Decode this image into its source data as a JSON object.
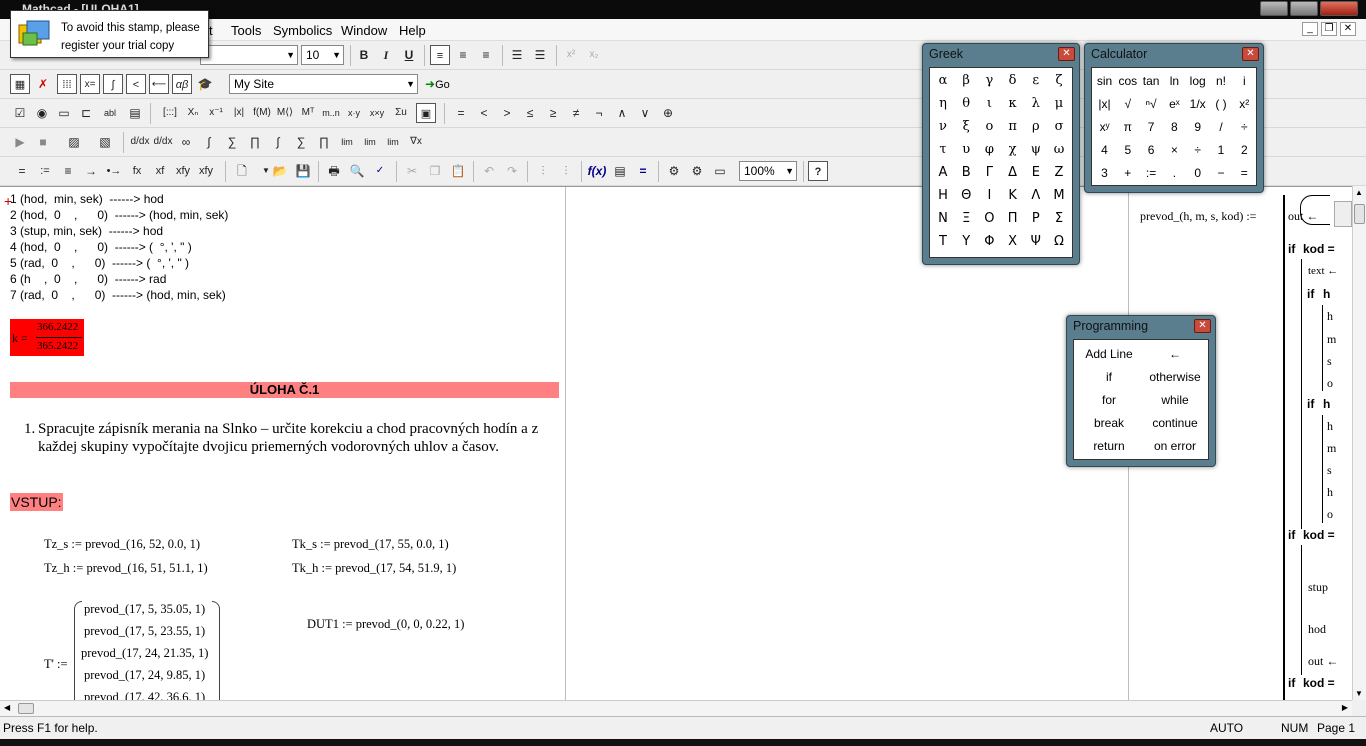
{
  "window": {
    "title": "Mathcad - [ULOHA1]"
  },
  "menubar": {
    "items": [
      "t",
      "Tools",
      "Symbolics",
      "Window",
      "Help"
    ]
  },
  "stamp": {
    "line1": "To avoid this stamp, please",
    "line2": "register your trial copy"
  },
  "format_toolbar": {
    "font_size": "10",
    "bold": "B",
    "italic": "I",
    "underline": "U",
    "superscript": "x²",
    "subscript": "x₂"
  },
  "resources_toolbar": {
    "site_value": "My Site",
    "go_label": "Go"
  },
  "evaluation_toolbar": {
    "symbols": [
      "=",
      ":=",
      "≡",
      "→",
      "•→",
      "fx",
      "xf",
      "xfy",
      "xfy"
    ]
  },
  "comparison_symbols": [
    "=",
    "<",
    ">",
    "≤",
    "≥",
    "≠",
    "¬",
    "∧",
    "∨",
    "⊕"
  ],
  "calculus_symbols": [
    "d/dx",
    "d/dx",
    "∞",
    "∫",
    "∑",
    "∏",
    "∫",
    "∑",
    "∏",
    "lim",
    "lim",
    "lim",
    "∇x"
  ],
  "matrix_symbols": [
    "[:::]",
    "Xₙ",
    "x⁻¹",
    "|x|",
    "f(M)",
    "M⟨⟩",
    "Mᵀ",
    "m..n",
    "x·y",
    "x×y",
    "Σu"
  ],
  "standard_toolbar": {
    "zoom_value": "100%"
  },
  "document": {
    "table_lines": [
      "1 (hod,  min, sek)  ------> hod",
      "2 (hod,  0    ,      0)  ------> (hod, min, sek)",
      "3 (stup, min, sek)  ------> hod",
      "4 (hod,  0    ,      0)  ------> (  °, ', \" )",
      "5 (rad,  0    ,      0)  ------> (  °, ', \" )",
      "6 (h    ,  0    ,      0)  ------> rad",
      "7 (rad,  0    ,      0)  ------> (hod, min, sek)"
    ],
    "k_label": "k =",
    "k_numerator": "366.2422",
    "k_denominator": "365.2422",
    "section_title": "ÚLOHA Č.1",
    "task_number": "1.",
    "task_text": "Spracujte zápisník merania na Slnko – určite korekciu a chod pracovných hodín a z každej skupiny vypočítajte dvojicu priemerných vodorovných uhlov a časov.",
    "input_label": "VSTUP:",
    "eq_tzs": "Tz_s := prevod_(16, 52, 0.0, 1)",
    "eq_tzh": "Tz_h := prevod_(16, 51, 51.1, 1)",
    "eq_tks": "Tk_s := prevod_(17, 55, 0.0, 1)",
    "eq_tkh": "Tk_h := prevod_(17, 54, 51.9, 1)",
    "eq_dut": "DUT1 := prevod_(0, 0, 0.22, 1)",
    "t_label": "T' :=",
    "t_rows": [
      "prevod_(17, 5, 35.05, 1)",
      "prevod_(17, 5, 23.55, 1)",
      "prevod_(17, 24, 21.35, 1)",
      "prevod_(17, 24, 9.85, 1)",
      "prevod_(17, 42, 36.6, 1)"
    ],
    "prog_def": "prevod_(h, m, s, kod) :=",
    "prog_out": "out ←",
    "prog_if": "if",
    "prog_kod": "kod =",
    "prog_text": "text ←",
    "prog_h": "h",
    "prog_m": "m",
    "prog_s": "s",
    "prog_o": "o",
    "prog_stup": "stup",
    "prog_hod": "hod"
  },
  "greek_palette": {
    "title": "Greek",
    "lower": [
      "α",
      "β",
      "γ",
      "δ",
      "ε",
      "ζ",
      "η",
      "θ",
      "ι",
      "κ",
      "λ",
      "μ",
      "ν",
      "ξ",
      "ο",
      "π",
      "ρ",
      "σ",
      "τ",
      "υ",
      "φ",
      "χ",
      "ψ",
      "ω"
    ],
    "upper": [
      "Α",
      "Β",
      "Γ",
      "Δ",
      "Ε",
      "Ζ",
      "Η",
      "Θ",
      "Ι",
      "Κ",
      "Λ",
      "Μ",
      "Ν",
      "Ξ",
      "Ο",
      "Π",
      "Ρ",
      "Σ",
      "Τ",
      "Υ",
      "Φ",
      "Χ",
      "Ψ",
      "Ω"
    ]
  },
  "calculator_palette": {
    "title": "Calculator",
    "keys": [
      "sin",
      "cos",
      "tan",
      "ln",
      "log",
      "n!",
      "i",
      "|x|",
      "√",
      "ⁿ√",
      "eˣ",
      "1/x",
      "( )",
      "x²",
      "xʸ",
      "π",
      "7",
      "8",
      "9",
      "/",
      "÷",
      "4",
      "5",
      "6",
      "×",
      "÷",
      "1",
      "2",
      "3",
      "+",
      ":=",
      ".",
      "0",
      "−",
      "="
    ]
  },
  "programming_palette": {
    "title": "Programming",
    "cells": [
      "Add Line",
      "←",
      "if",
      "otherwise",
      "for",
      "while",
      "break",
      "continue",
      "return",
      "on error"
    ]
  },
  "status": {
    "help": "Press F1 for help.",
    "mode": "AUTO",
    "num": "NUM",
    "page": "Page 1"
  }
}
